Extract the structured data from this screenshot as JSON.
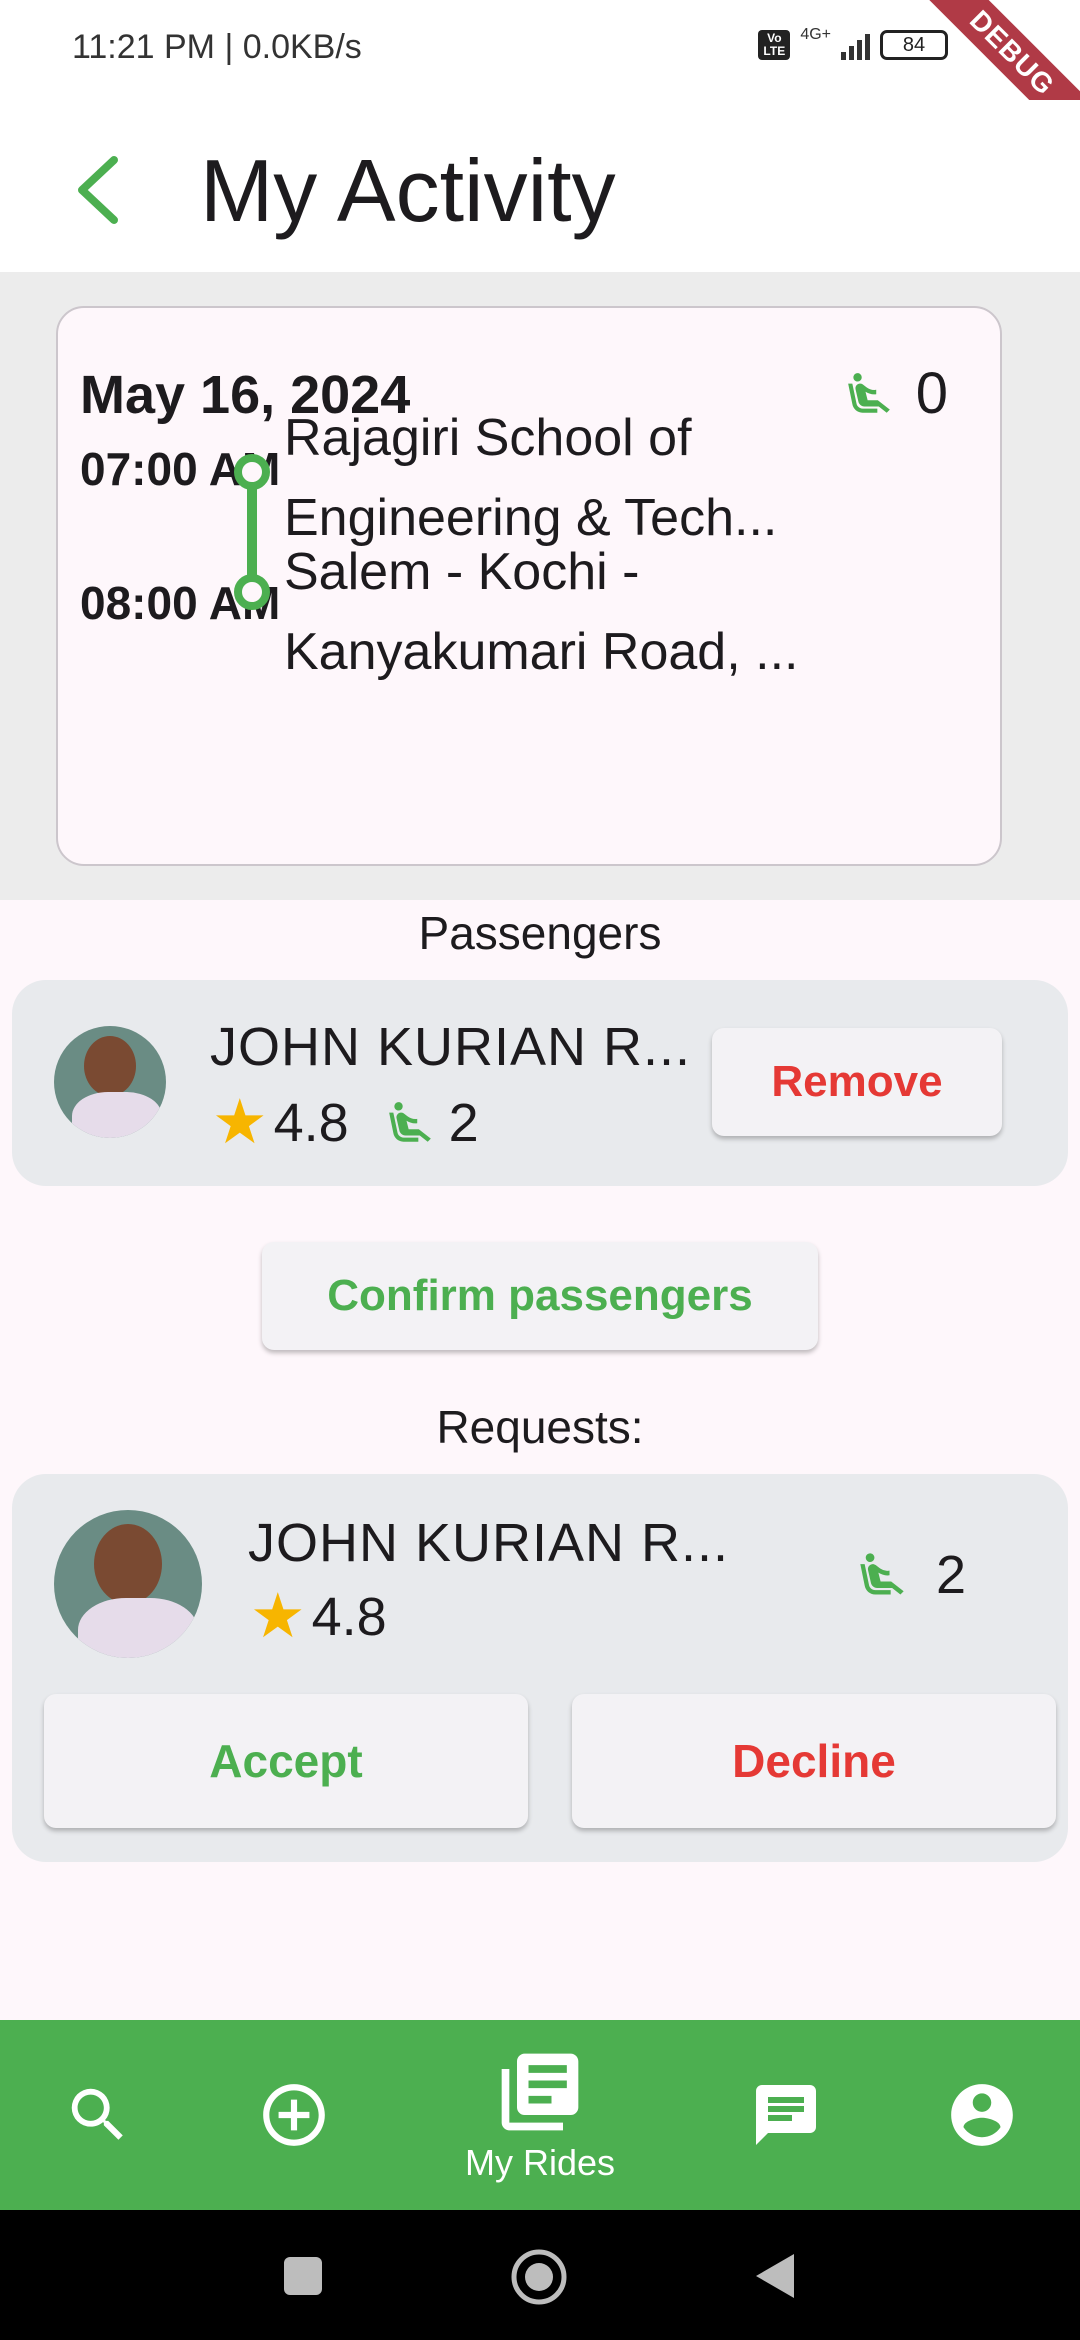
{
  "status_bar": {
    "time": "11:21 PM | 0.0KB/s",
    "network": "4G+",
    "volte": "Vo LTE",
    "battery": "84"
  },
  "debug_banner": "DEBUG",
  "app_bar": {
    "back_icon": "chevron-left-icon",
    "title": "My Activity"
  },
  "ride": {
    "date": "May 16, 2024",
    "available_seats": "0",
    "stops": [
      {
        "time": "07:00 AM",
        "location_line1": "Rajagiri School of",
        "location_line2": "Engineering & Tech..."
      },
      {
        "time": "08:00 AM",
        "location_line1": "Salem - Kochi -",
        "location_line2": "Kanyakumari Road, ..."
      }
    ]
  },
  "passengers": {
    "heading": "Passengers",
    "items": [
      {
        "name": "JOHN KURIAN R...",
        "rating": "4.8",
        "seats": "2",
        "remove_label": "Remove"
      }
    ],
    "confirm_label": "Confirm passengers"
  },
  "requests": {
    "heading": "Requests:",
    "items": [
      {
        "name": "JOHN KURIAN R...",
        "rating": "4.8",
        "seats": "2",
        "accept_label": "Accept",
        "decline_label": "Decline"
      }
    ]
  },
  "bottom_nav": {
    "items": [
      {
        "icon": "search-icon",
        "label": ""
      },
      {
        "icon": "add-circle-icon",
        "label": ""
      },
      {
        "icon": "my-rides-icon",
        "label": "My Rides",
        "active": true
      },
      {
        "icon": "chat-icon",
        "label": ""
      },
      {
        "icon": "account-icon",
        "label": ""
      }
    ]
  },
  "colors": {
    "primary": "#4CAF50",
    "danger": "#E53935",
    "star": "#F7B500",
    "card": "#E8EAED",
    "background": "#FEF7FB"
  }
}
